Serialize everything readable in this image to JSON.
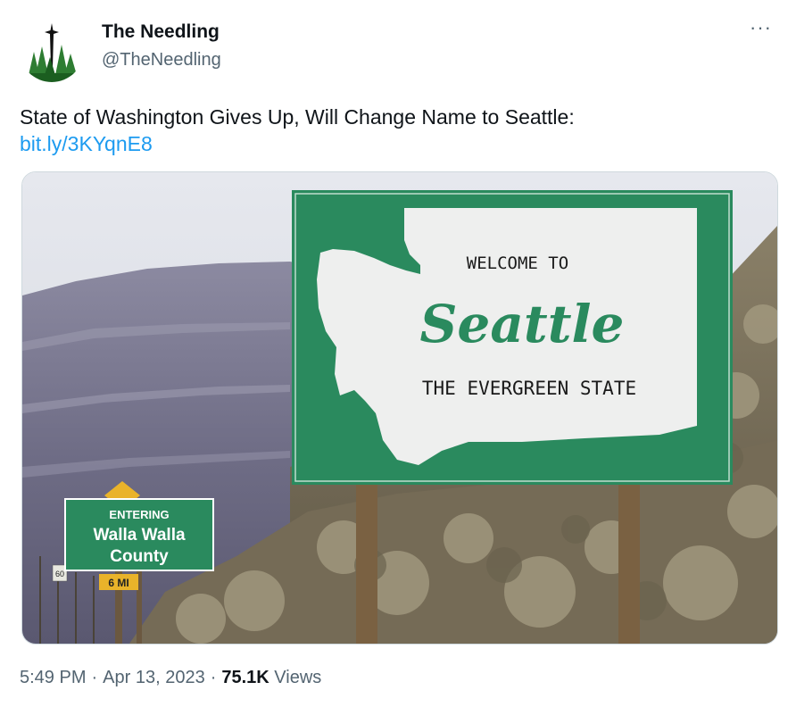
{
  "author": {
    "display_name": "The Needling",
    "handle": "@TheNeedling",
    "avatar_icon": "space-needle-forest-icon"
  },
  "more_icon": "ellipsis-icon",
  "more_label": "···",
  "tweet": {
    "text": "State of Washington Gives Up, Will Change Name to Seattle:",
    "link": "bit.ly/3KYqnE8"
  },
  "image": {
    "welcome_text": "WELCOME TO",
    "city_text": "Seattle",
    "state_slogan": "THE EVERGREEN STATE",
    "county_sign_line1": "ENTERING",
    "county_sign_line2": "Walla Walla",
    "county_sign_line3": "County",
    "distance_sign": "6 MI",
    "route_marker": "60"
  },
  "meta": {
    "time": "5:49 PM",
    "date": "Apr 13, 2023",
    "views_count": "75.1K",
    "views_label": "Views",
    "separator": "·"
  },
  "colors": {
    "sign_green": "#2a8a5e",
    "link_blue": "#1d9bf0",
    "secondary_text": "#536471"
  }
}
